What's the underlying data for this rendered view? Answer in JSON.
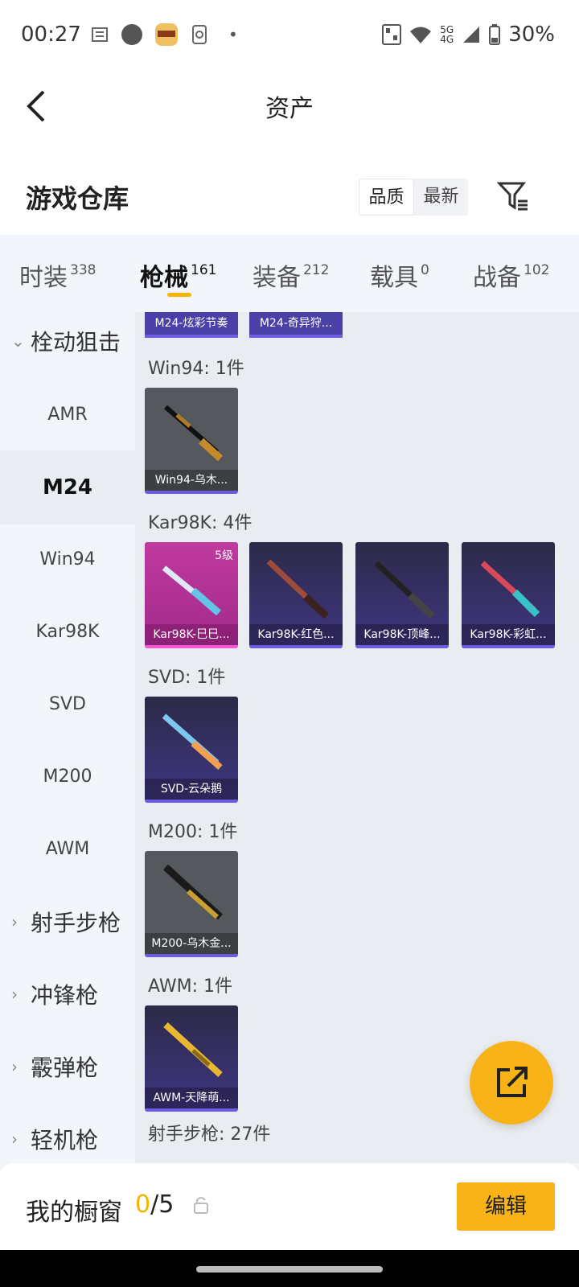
{
  "status_bar": {
    "time": "00:27",
    "network": "5G\n4G",
    "battery": "30%"
  },
  "header": {
    "title": "资产"
  },
  "subhead": {
    "title": "游戏仓库",
    "sort_options": [
      "品质",
      "最新"
    ],
    "selected_sort": "品质"
  },
  "tabs": [
    {
      "label": "时装",
      "count": "338"
    },
    {
      "label": "枪械",
      "count": "161",
      "active": true
    },
    {
      "label": "装备",
      "count": "212"
    },
    {
      "label": "载具",
      "count": "0"
    },
    {
      "label": "战备",
      "count": "102"
    }
  ],
  "sidebar": {
    "category_open": "栓动狙击",
    "items": [
      "AMR",
      "M24",
      "Win94",
      "Kar98K",
      "SVD",
      "M200",
      "AWM"
    ],
    "selected": "M24",
    "collapsed_categories": [
      "射手步枪",
      "冲锋枪",
      "霰弹枪",
      "轻机枪"
    ]
  },
  "groups": {
    "m24_top_cards": [
      "M24-炫彩节奏",
      "M24-奇异狩..."
    ],
    "win94": {
      "label": "Win94: 1件",
      "cards": [
        "Win94-乌木..."
      ]
    },
    "kar98k": {
      "label": "Kar98K: 4件",
      "cards": [
        "Kar98K-巳巳...",
        "Kar98K-红色...",
        "Kar98K-顶峰...",
        "Kar98K-彩虹..."
      ],
      "first_level": "5级"
    },
    "svd": {
      "label": "SVD: 1件",
      "cards": [
        "SVD-云朵鹅"
      ]
    },
    "m200": {
      "label": "M200: 1件",
      "cards": [
        "M200-乌木金..."
      ]
    },
    "awm": {
      "label": "AWM: 1件",
      "cards": [
        "AWM-天降萌..."
      ]
    },
    "dmr": {
      "label": "射手步枪: 27件"
    }
  },
  "bottom_bar": {
    "label": "我的橱窗",
    "current": "0",
    "total": "/5",
    "edit_label": "编辑"
  },
  "colors": {
    "accent": "#f8b318",
    "rarity_purple": "#6b5ce0",
    "rarity_pink": "#f05ad0"
  }
}
